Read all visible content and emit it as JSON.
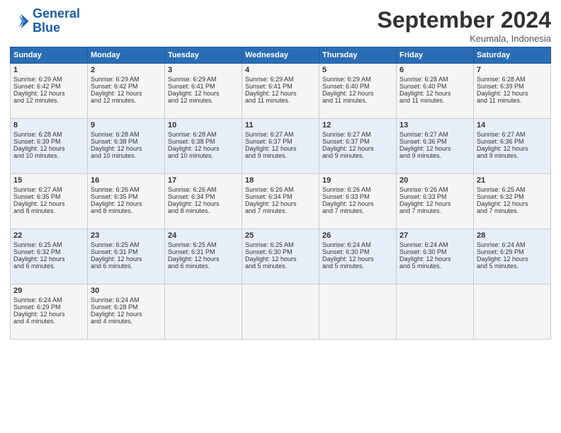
{
  "logo": {
    "line1": "General",
    "line2": "Blue"
  },
  "title": "September 2024",
  "subtitle": "Keumala, Indonesia",
  "days_of_week": [
    "Sunday",
    "Monday",
    "Tuesday",
    "Wednesday",
    "Thursday",
    "Friday",
    "Saturday"
  ],
  "weeks": [
    [
      {
        "day": "1",
        "lines": [
          "Sunrise: 6:29 AM",
          "Sunset: 6:42 PM",
          "Daylight: 12 hours",
          "and 12 minutes."
        ]
      },
      {
        "day": "2",
        "lines": [
          "Sunrise: 6:29 AM",
          "Sunset: 6:42 PM",
          "Daylight: 12 hours",
          "and 12 minutes."
        ]
      },
      {
        "day": "3",
        "lines": [
          "Sunrise: 6:29 AM",
          "Sunset: 6:41 PM",
          "Daylight: 12 hours",
          "and 12 minutes."
        ]
      },
      {
        "day": "4",
        "lines": [
          "Sunrise: 6:29 AM",
          "Sunset: 6:41 PM",
          "Daylight: 12 hours",
          "and 11 minutes."
        ]
      },
      {
        "day": "5",
        "lines": [
          "Sunrise: 6:29 AM",
          "Sunset: 6:40 PM",
          "Daylight: 12 hours",
          "and 11 minutes."
        ]
      },
      {
        "day": "6",
        "lines": [
          "Sunrise: 6:28 AM",
          "Sunset: 6:40 PM",
          "Daylight: 12 hours",
          "and 11 minutes."
        ]
      },
      {
        "day": "7",
        "lines": [
          "Sunrise: 6:28 AM",
          "Sunset: 6:39 PM",
          "Daylight: 12 hours",
          "and 11 minutes."
        ]
      }
    ],
    [
      {
        "day": "8",
        "lines": [
          "Sunrise: 6:28 AM",
          "Sunset: 6:39 PM",
          "Daylight: 12 hours",
          "and 10 minutes."
        ]
      },
      {
        "day": "9",
        "lines": [
          "Sunrise: 6:28 AM",
          "Sunset: 6:38 PM",
          "Daylight: 12 hours",
          "and 10 minutes."
        ]
      },
      {
        "day": "10",
        "lines": [
          "Sunrise: 6:28 AM",
          "Sunset: 6:38 PM",
          "Daylight: 12 hours",
          "and 10 minutes."
        ]
      },
      {
        "day": "11",
        "lines": [
          "Sunrise: 6:27 AM",
          "Sunset: 6:37 PM",
          "Daylight: 12 hours",
          "and 9 minutes."
        ]
      },
      {
        "day": "12",
        "lines": [
          "Sunrise: 6:27 AM",
          "Sunset: 6:37 PM",
          "Daylight: 12 hours",
          "and 9 minutes."
        ]
      },
      {
        "day": "13",
        "lines": [
          "Sunrise: 6:27 AM",
          "Sunset: 6:36 PM",
          "Daylight: 12 hours",
          "and 9 minutes."
        ]
      },
      {
        "day": "14",
        "lines": [
          "Sunrise: 6:27 AM",
          "Sunset: 6:36 PM",
          "Daylight: 12 hours",
          "and 9 minutes."
        ]
      }
    ],
    [
      {
        "day": "15",
        "lines": [
          "Sunrise: 6:27 AM",
          "Sunset: 6:35 PM",
          "Daylight: 12 hours",
          "and 8 minutes."
        ]
      },
      {
        "day": "16",
        "lines": [
          "Sunrise: 6:26 AM",
          "Sunset: 6:35 PM",
          "Daylight: 12 hours",
          "and 8 minutes."
        ]
      },
      {
        "day": "17",
        "lines": [
          "Sunrise: 6:26 AM",
          "Sunset: 6:34 PM",
          "Daylight: 12 hours",
          "and 8 minutes."
        ]
      },
      {
        "day": "18",
        "lines": [
          "Sunrise: 6:26 AM",
          "Sunset: 6:34 PM",
          "Daylight: 12 hours",
          "and 7 minutes."
        ]
      },
      {
        "day": "19",
        "lines": [
          "Sunrise: 6:26 AM",
          "Sunset: 6:33 PM",
          "Daylight: 12 hours",
          "and 7 minutes."
        ]
      },
      {
        "day": "20",
        "lines": [
          "Sunrise: 6:26 AM",
          "Sunset: 6:33 PM",
          "Daylight: 12 hours",
          "and 7 minutes."
        ]
      },
      {
        "day": "21",
        "lines": [
          "Sunrise: 6:25 AM",
          "Sunset: 6:32 PM",
          "Daylight: 12 hours",
          "and 7 minutes."
        ]
      }
    ],
    [
      {
        "day": "22",
        "lines": [
          "Sunrise: 6:25 AM",
          "Sunset: 6:32 PM",
          "Daylight: 12 hours",
          "and 6 minutes."
        ]
      },
      {
        "day": "23",
        "lines": [
          "Sunrise: 6:25 AM",
          "Sunset: 6:31 PM",
          "Daylight: 12 hours",
          "and 6 minutes."
        ]
      },
      {
        "day": "24",
        "lines": [
          "Sunrise: 6:25 AM",
          "Sunset: 6:31 PM",
          "Daylight: 12 hours",
          "and 6 minutes."
        ]
      },
      {
        "day": "25",
        "lines": [
          "Sunrise: 6:25 AM",
          "Sunset: 6:30 PM",
          "Daylight: 12 hours",
          "and 5 minutes."
        ]
      },
      {
        "day": "26",
        "lines": [
          "Sunrise: 6:24 AM",
          "Sunset: 6:30 PM",
          "Daylight: 12 hours",
          "and 5 minutes."
        ]
      },
      {
        "day": "27",
        "lines": [
          "Sunrise: 6:24 AM",
          "Sunset: 6:30 PM",
          "Daylight: 12 hours",
          "and 5 minutes."
        ]
      },
      {
        "day": "28",
        "lines": [
          "Sunrise: 6:24 AM",
          "Sunset: 6:29 PM",
          "Daylight: 12 hours",
          "and 5 minutes."
        ]
      }
    ],
    [
      {
        "day": "29",
        "lines": [
          "Sunrise: 6:24 AM",
          "Sunset: 6:29 PM",
          "Daylight: 12 hours",
          "and 4 minutes."
        ]
      },
      {
        "day": "30",
        "lines": [
          "Sunrise: 6:24 AM",
          "Sunset: 6:28 PM",
          "Daylight: 12 hours",
          "and 4 minutes."
        ]
      },
      {
        "day": "",
        "lines": []
      },
      {
        "day": "",
        "lines": []
      },
      {
        "day": "",
        "lines": []
      },
      {
        "day": "",
        "lines": []
      },
      {
        "day": "",
        "lines": []
      }
    ]
  ]
}
